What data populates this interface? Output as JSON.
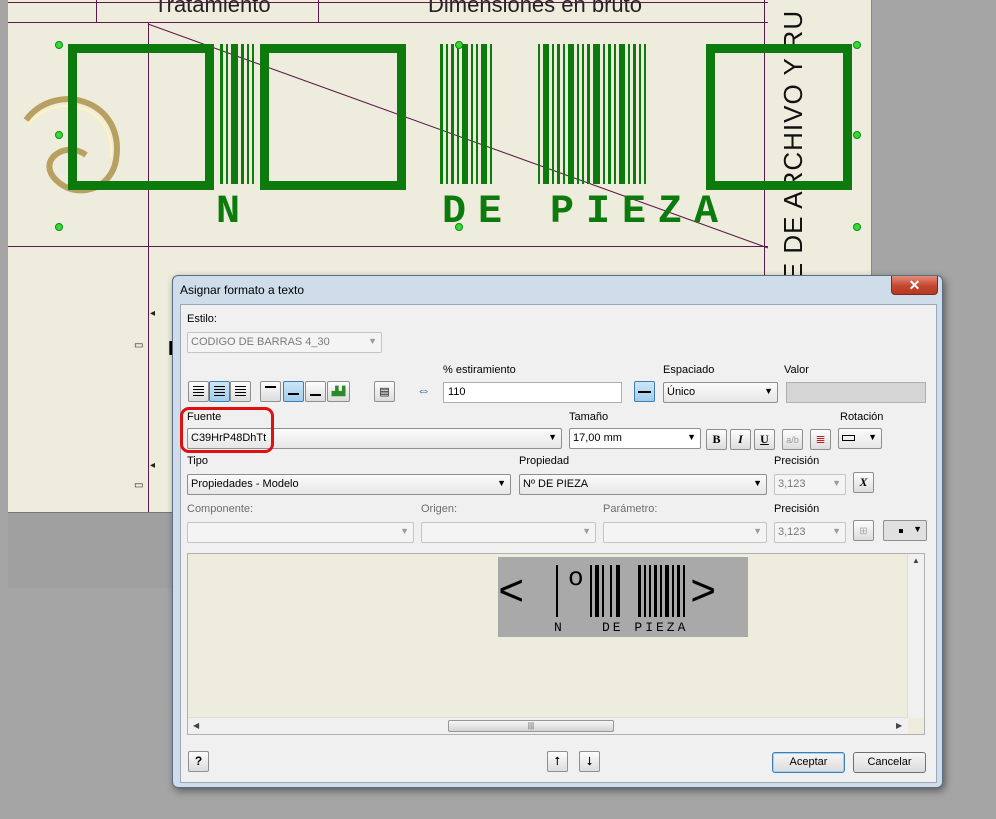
{
  "background": {
    "header_left": "Tratamiento",
    "header_right": "Dimensiones en bruto",
    "vertical_title": "RE DE ARCHIVO Y RU",
    "barcode_label_left": "N",
    "barcode_label_right": "DE PIEZA",
    "partial_text": "P"
  },
  "dialog": {
    "title": "Asignar formato a texto",
    "close_label": "✕",
    "estilo": {
      "label": "Estilo:",
      "value": "CODIGO DE BARRAS 4_30"
    },
    "estiramiento": {
      "label": "% estiramiento",
      "value": "110"
    },
    "espaciado": {
      "label": "Espaciado",
      "value": "Único"
    },
    "valor": {
      "label": "Valor",
      "value": ""
    },
    "fuente": {
      "label": "Fuente",
      "value": "C39HrP48DhTt"
    },
    "tamano": {
      "label": "Tamaño",
      "value": "17,00 mm"
    },
    "rotacion": {
      "label": "Rotación"
    },
    "format_buttons": {
      "bold": "B",
      "italic": "I",
      "underline": "U"
    },
    "tipo": {
      "label": "Tipo",
      "value": "Propiedades - Modelo"
    },
    "propiedad": {
      "label": "Propiedad",
      "value": "Nº DE PIEZA"
    },
    "precision1": {
      "label": "Precisión",
      "value": "3,123"
    },
    "componente": {
      "label": "Componente:",
      "value": ""
    },
    "origen": {
      "label": "Origen:",
      "value": ""
    },
    "parametro": {
      "label": "Parámetro:",
      "value": ""
    },
    "precision2": {
      "label": "Precisión",
      "value": "3,123"
    },
    "preview": {
      "left_chevron": "<",
      "right_chevron": ">",
      "o_char": "o",
      "text_n": "N",
      "text_pieza": "DE PIEZA",
      "scroll_thumb": "|||"
    },
    "buttons": {
      "help": "?",
      "aceptar": "Aceptar",
      "cancelar": "Cancelar"
    }
  },
  "colors": {
    "barcode_green": "#0c7a0c",
    "highlight_red": "#e01010",
    "grip_green": "#33dd33"
  }
}
